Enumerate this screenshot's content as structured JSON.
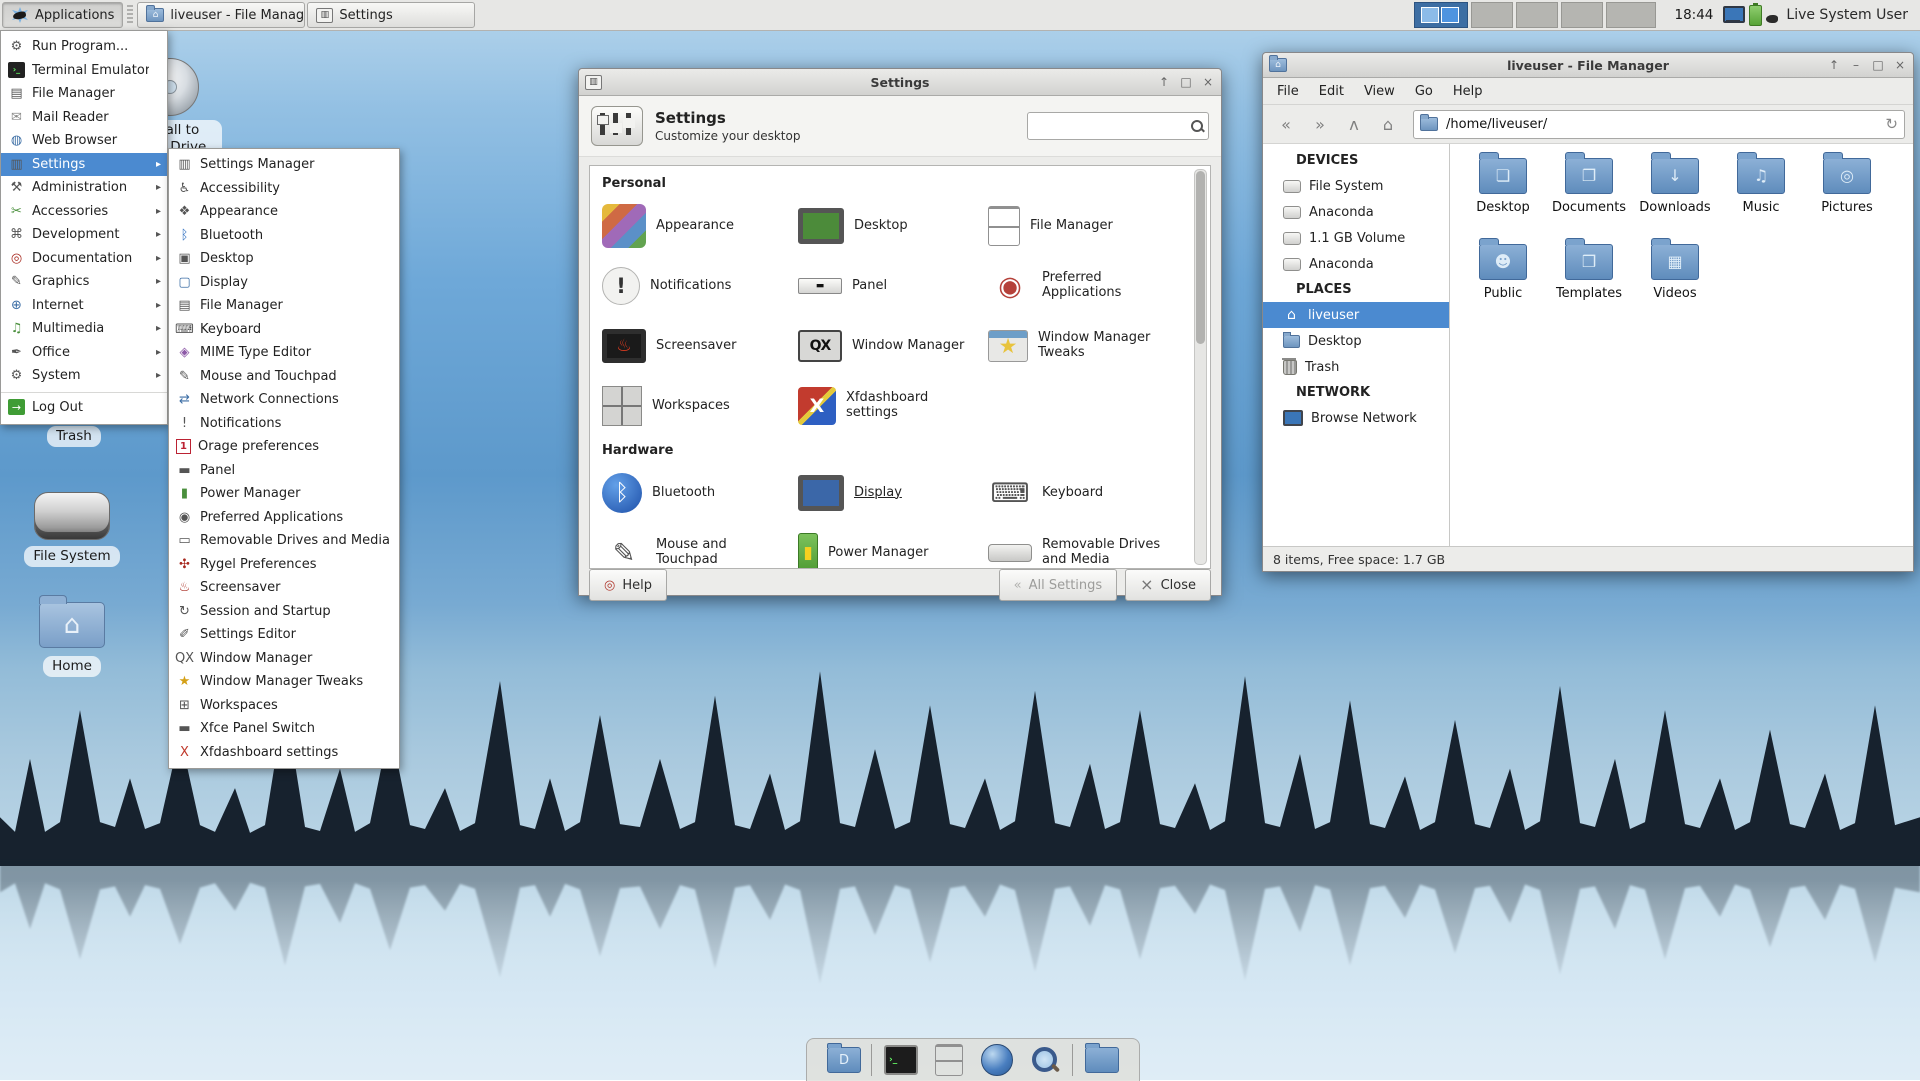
{
  "colors": {
    "selection_blue": "#4b8ad0",
    "panel_bg": "#e7e7e5",
    "folder_blue": "#6e95bf",
    "active_workspace": "#3d6ea3",
    "silhouette": "#17222e"
  },
  "glyphs": {
    "arrow": "▸",
    "shade": "↑",
    "minimize": "–",
    "maximize": "□",
    "close": "×",
    "back": "«",
    "forward": "»",
    "up": "ʌ",
    "home": "⌂",
    "reload": "↻",
    "help": "◎",
    "all_settings": "«",
    "close_x": "×"
  },
  "icon_glyphs": {
    "run-program": "⚙",
    "terminal-emulator": "›_",
    "file-manager": "▤",
    "mail-reader": "✉",
    "web-browser": "◍",
    "settings": "▥",
    "administration": "⚒",
    "accessories": "✂",
    "development": "⌘",
    "documentation": "◎",
    "graphics": "✎",
    "internet": "⊕",
    "multimedia": "♫",
    "office": "✒",
    "system": "⚙",
    "log-out": "→",
    "settings-manager": "▥",
    "accessibility": "♿",
    "appearance": "❖",
    "bluetooth": "ᛒ",
    "desktop": "▣",
    "display": "▢",
    "keyboard": "⌨",
    "mime-type-editor": "◈",
    "mouse-touchpad": "✎",
    "network-connections": "⇄",
    "notifications": "!",
    "orage": "1",
    "panel": "▬",
    "power-manager": "▮",
    "preferred-applications": "◉",
    "removable-drives": "▭",
    "rygel": "✣",
    "screensaver": "♨",
    "session-startup": "↻",
    "settings-editor": "✐",
    "window-manager": "QX",
    "window-manager-tweaks": "★",
    "workspaces": "⊞",
    "xfce-panel-switch": "▬",
    "xfdashboard": "X",
    "task-files": "",
    "task-settings": "",
    "home": "⌂",
    "dock-desktop": "D",
    "dock-terminal": "›_"
  },
  "panel": {
    "applications_label": "Applications",
    "taskbar": [
      {
        "label": "liveuser - File Manager"
      },
      {
        "label": "Settings"
      }
    ],
    "clock": "18:44",
    "user_label": "Live System User",
    "workspace_count": 5,
    "active_workspace": 1
  },
  "applications_menu": {
    "items": [
      {
        "icon": "run-program",
        "label": "Run Program..."
      },
      {
        "icon": "terminal-emulator",
        "label": "Terminal Emulator"
      },
      {
        "icon": "file-manager",
        "label": "File Manager"
      },
      {
        "icon": "mail-reader",
        "label": "Mail Reader"
      },
      {
        "icon": "web-browser",
        "label": "Web Browser"
      },
      {
        "icon": "settings",
        "label": "Settings",
        "submenu": true,
        "highlighted": true
      },
      {
        "icon": "administration",
        "label": "Administration",
        "submenu": true
      },
      {
        "icon": "accessories",
        "label": "Accessories",
        "submenu": true
      },
      {
        "icon": "development",
        "label": "Development",
        "submenu": true
      },
      {
        "icon": "documentation",
        "label": "Documentation",
        "submenu": true
      },
      {
        "icon": "graphics",
        "label": "Graphics",
        "submenu": true
      },
      {
        "icon": "internet",
        "label": "Internet",
        "submenu": true
      },
      {
        "icon": "multimedia",
        "label": "Multimedia",
        "submenu": true
      },
      {
        "icon": "office",
        "label": "Office",
        "submenu": true
      },
      {
        "icon": "system",
        "label": "System",
        "submenu": true
      },
      {
        "icon": "log-out",
        "label": "Log Out",
        "separator_before": true
      }
    ]
  },
  "settings_submenu": {
    "items": [
      {
        "icon": "settings-manager",
        "label": "Settings Manager"
      },
      {
        "icon": "accessibility",
        "label": "Accessibility"
      },
      {
        "icon": "appearance",
        "label": "Appearance"
      },
      {
        "icon": "bluetooth",
        "label": "Bluetooth"
      },
      {
        "icon": "desktop",
        "label": "Desktop"
      },
      {
        "icon": "display",
        "label": "Display"
      },
      {
        "icon": "file-manager",
        "label": "File Manager"
      },
      {
        "icon": "keyboard",
        "label": "Keyboard"
      },
      {
        "icon": "mime-type-editor",
        "label": "MIME Type Editor"
      },
      {
        "icon": "mouse-touchpad",
        "label": "Mouse and Touchpad"
      },
      {
        "icon": "network-connections",
        "label": "Network Connections"
      },
      {
        "icon": "notifications",
        "label": "Notifications"
      },
      {
        "icon": "orage",
        "label": "Orage preferences"
      },
      {
        "icon": "panel",
        "label": "Panel"
      },
      {
        "icon": "power-manager",
        "label": "Power Manager"
      },
      {
        "icon": "preferred-applications",
        "label": "Preferred Applications"
      },
      {
        "icon": "removable-drives",
        "label": "Removable Drives and Media"
      },
      {
        "icon": "rygel",
        "label": "Rygel Preferences"
      },
      {
        "icon": "screensaver",
        "label": "Screensaver"
      },
      {
        "icon": "session-startup",
        "label": "Session and Startup"
      },
      {
        "icon": "settings-editor",
        "label": "Settings Editor"
      },
      {
        "icon": "window-manager",
        "label": "Window Manager"
      },
      {
        "icon": "window-manager-tweaks",
        "label": "Window Manager Tweaks"
      },
      {
        "icon": "workspaces",
        "label": "Workspaces"
      },
      {
        "icon": "xfce-panel-switch",
        "label": "Xfce Panel Switch"
      },
      {
        "icon": "xfdashboard",
        "label": "Xfdashboard settings"
      }
    ]
  },
  "desktop": {
    "icons": [
      {
        "label": "Install to Hard Drive"
      },
      {
        "label": "Trash"
      },
      {
        "label": "File System"
      },
      {
        "label": "Home"
      }
    ]
  },
  "settings_window": {
    "title": "Settings",
    "header_title": "Settings",
    "header_subtitle": "Customize your desktop",
    "personal_label": "Personal",
    "hardware_label": "Hardware",
    "personal_items": [
      {
        "icon": "appearance",
        "label": "Appearance"
      },
      {
        "icon": "desktop",
        "label": "Desktop"
      },
      {
        "icon": "file-manager",
        "label": "File Manager"
      },
      {
        "icon": "notifications",
        "label": "Notifications"
      },
      {
        "icon": "panel",
        "label": "Panel"
      },
      {
        "icon": "preferred-applications",
        "label": "Preferred Applications"
      },
      {
        "icon": "screensaver",
        "label": "Screensaver"
      },
      {
        "icon": "window-manager",
        "label": "Window Manager"
      },
      {
        "icon": "window-manager-tweaks",
        "label": "Window Manager Tweaks"
      },
      {
        "icon": "workspaces",
        "label": "Workspaces"
      },
      {
        "icon": "xfdashboard",
        "label": "Xfdashboard settings"
      }
    ],
    "hardware_items": [
      {
        "icon": "bluetooth",
        "label": "Bluetooth"
      },
      {
        "icon": "display",
        "label": "Display",
        "underline": true
      },
      {
        "icon": "keyboard",
        "label": "Keyboard"
      },
      {
        "icon": "mouse-touchpad",
        "label": "Mouse and Touchpad"
      },
      {
        "icon": "power-manager",
        "label": "Power Manager"
      },
      {
        "icon": "removable-drives",
        "label": "Removable Drives and Media"
      }
    ],
    "help_label": "Help",
    "all_settings_label": "All Settings",
    "close_label": "Close"
  },
  "file_manager": {
    "title": "liveuser - File Manager",
    "menu": [
      {
        "label": "File"
      },
      {
        "label": "Edit"
      },
      {
        "label": "View"
      },
      {
        "label": "Go"
      },
      {
        "label": "Help"
      }
    ],
    "path": "/home/liveuser/",
    "sidebar": [
      {
        "type": "header",
        "label": "DEVICES"
      },
      {
        "type": "item",
        "icon": "drive",
        "label": "File System"
      },
      {
        "type": "item",
        "icon": "drive",
        "label": "Anaconda"
      },
      {
        "type": "item",
        "icon": "drive",
        "label": "1.1 GB Volume"
      },
      {
        "type": "item",
        "icon": "drive",
        "label": "Anaconda"
      },
      {
        "type": "header",
        "label": "PLACES"
      },
      {
        "type": "item",
        "icon": "home",
        "label": "liveuser",
        "selected": true
      },
      {
        "type": "item",
        "icon": "folder",
        "label": "Desktop"
      },
      {
        "type": "item",
        "icon": "trash",
        "label": "Trash"
      },
      {
        "type": "header",
        "label": "NETWORK"
      },
      {
        "type": "item",
        "icon": "network",
        "label": "Browse Network"
      }
    ],
    "files": [
      {
        "label": "Desktop",
        "emblem": "❏"
      },
      {
        "label": "Documents",
        "emblem": "❐"
      },
      {
        "label": "Downloads",
        "emblem": "↓"
      },
      {
        "label": "Music",
        "emblem": "♫"
      },
      {
        "label": "Pictures",
        "emblem": "◎"
      },
      {
        "label": "Public",
        "emblem": "☻"
      },
      {
        "label": "Templates",
        "emblem": "❒"
      },
      {
        "label": "Videos",
        "emblem": "▦"
      }
    ],
    "status": "8 items, Free space: 1.7 GB"
  },
  "dock": {
    "items": [
      {
        "icon": "dock-desktop"
      },
      {
        "icon": "dock-terminal",
        "sep_before": true
      },
      {
        "icon": "dock-files"
      },
      {
        "icon": "dock-browser"
      },
      {
        "icon": "dock-search"
      },
      {
        "icon": "dock-folder",
        "sep_before": true
      }
    ]
  }
}
